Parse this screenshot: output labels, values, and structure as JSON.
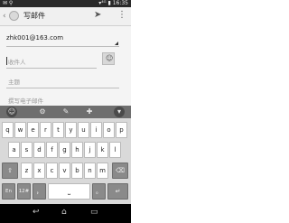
{
  "status": {
    "left_icons": "✉ ⚲",
    "right_text": "▾⁴ᴳ ▮ 16:35"
  },
  "appbar": {
    "back_glyph": "‹",
    "title": "写邮件",
    "send_glyph": "➤",
    "menu_glyph": "⋮"
  },
  "compose": {
    "from": "zhk001@163.com",
    "to_placeholder": "收件人",
    "subject_placeholder": "主题",
    "body_placeholder": "撰写电子邮件",
    "contact_glyph": "☺"
  },
  "ime_toolbar": [
    "☺",
    "⚙",
    "✎",
    "✚",
    "▾"
  ],
  "keyboard": {
    "row1": [
      "q",
      "w",
      "e",
      "r",
      "t",
      "y",
      "u",
      "i",
      "o",
      "p"
    ],
    "row2": [
      "a",
      "s",
      "d",
      "f",
      "g",
      "h",
      "j",
      "k",
      "l"
    ],
    "row3": [
      "⇧",
      "z",
      "x",
      "c",
      "v",
      "b",
      "n",
      "m",
      "⌫"
    ],
    "row4": {
      "lang": "En",
      "num": "12#",
      "comma": "，",
      "space": "⎵",
      "period": "。",
      "enter": "↵"
    }
  },
  "navbar": {
    "back": "↩",
    "home": "⌂",
    "recent": "▭"
  }
}
